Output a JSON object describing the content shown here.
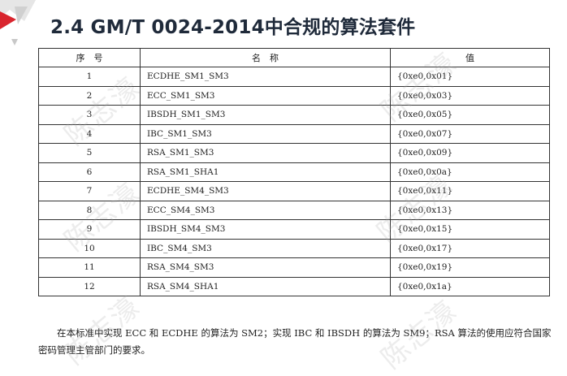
{
  "title": "2.4 GM/T 0024-2014中合规的算法套件",
  "watermark": "陈志濠",
  "table": {
    "headers": [
      "序　号",
      "名　称",
      "值"
    ],
    "rows": [
      {
        "no": "1",
        "name": "ECDHE_SM1_SM3",
        "value": "{0xe0,0x01}"
      },
      {
        "no": "2",
        "name": "ECC_SM1_SM3",
        "value": "{0xe0,0x03}"
      },
      {
        "no": "3",
        "name": "IBSDH_SM1_SM3",
        "value": "{0xe0,0x05}"
      },
      {
        "no": "4",
        "name": "IBC_SM1_SM3",
        "value": "{0xe0,0x07}"
      },
      {
        "no": "5",
        "name": "RSA_SM1_SM3",
        "value": "{0xe0,0x09}"
      },
      {
        "no": "6",
        "name": "RSA_SM1_SHA1",
        "value": "{0xe0,0x0a}"
      },
      {
        "no": "7",
        "name": "ECDHE_SM4_SM3",
        "value": "{0xe0,0x11}"
      },
      {
        "no": "8",
        "name": "ECC_SM4_SM3",
        "value": "{0xe0,0x13}"
      },
      {
        "no": "9",
        "name": "IBSDH_SM4_SM3",
        "value": "{0xe0,0x15}"
      },
      {
        "no": "10",
        "name": "IBC_SM4_SM3",
        "value": "{0xe0,0x17}"
      },
      {
        "no": "11",
        "name": "RSA_SM4_SM3",
        "value": "{0xe0,0x19}"
      },
      {
        "no": "12",
        "name": "RSA_SM4_SHA1",
        "value": "{0xe0,0x1a}"
      }
    ]
  },
  "note": "在本标准中实现 ECC 和 ECDHE 的算法为 SM2；实现 IBC 和 IBSDH 的算法为 SM9；RSA 算法的使用应符合国家密码管理主管部门的要求。",
  "colors": {
    "logo_red": "#d9252e",
    "logo_grey": "#c8c8c8",
    "title": "#1f2a3a"
  }
}
